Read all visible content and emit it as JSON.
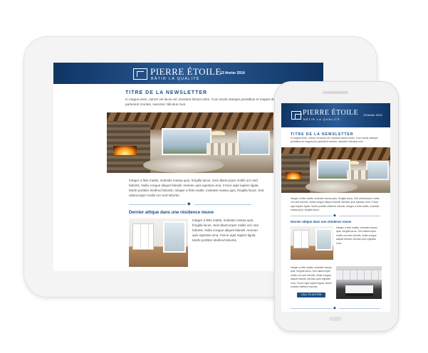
{
  "brand": {
    "name": "PIERRE ÉTOILE",
    "tagline": "BÂTIR LA QUALITÉ"
  },
  "tablet": {
    "header_date": "13 février 2014",
    "newsletter_title": "TITRE DE LA NEWSLETTER",
    "intro_text": "In magna enim, rutrum vel lacus vel, tincidunt dictum enim. Cum sociis natoque penatibus et magnis dis parturient montes, nascetur ridiculus mus.",
    "article_text": "Integer a felis mattis, molestie massa quis, fringilla lacus. Sed ullamcorper mollis orci sed lobortis. Nulla congue aliquet blandit. Aenean quis egestas urna. Fusce eget sapien ligula. Morbi porttitor eleifend lobortis. Integer a felis mattis, molestie massa quis, fringilla lacus. Sed ullamcorper mollis orci sed lobortis.",
    "section_heading": "Dernier attique dans une résidence neuve",
    "section_text": "Integer a felis mattis, molestie massa quis, fringilla lacus. Sed ullamcorper mollis orci sed lobortis. Nulla congue aliquet blandit. Aenean quis egestas urna. Fusce eget sapien ligula. Morbi porttitor eleifend lobortis."
  },
  "phone": {
    "header_date": "13 février 2014",
    "newsletter_title": "TITRE DE LA NEWSLETTER",
    "intro_text": "In magna enim, rutrum vel lacus vel, tincidunt dictum enim. Cum sociis natoque penatibus et magnis dis parturient montes, nascetur ridiculus mus.",
    "article_text": "Integer a felis mattis, molestie massa quis, fringilla lacus. Sed ullamcorper mollis orci sed lobortis. Nulla congue aliquet blandit. Aenean quis egestas urna. Fusce eget sapien ligula. Morbi porttitor eleifend lobortis. Integer a felis mattis, molestie massa quis, fringilla lacus.",
    "section_heading": "Dernier attique dans une résidence neuve",
    "section_text": "Integer a felis mattis, molestie massa quis, fringilla lacus. Sed ullamcorper mollis orci sed lobortis. Nulla congue aliquet blandit. Aenean quis egestas urna.",
    "kitchen_text": "Integer a felis mattis, molestie massa quis, fringilla lacus. Sed ullamcorper mollis orci sed lobortis. Nulla congue aliquet blandit. Aenean quis egestas urna. Fusce eget sapien ligula. Morbi porttitor eleifend lobortis.",
    "cta_label": "CALL TO ACTION"
  },
  "colors": {
    "brand_blue": "#1d4f86",
    "header_dark": "#0f3564"
  },
  "icons": {
    "logo": "house-logo-icon",
    "divider": "diamond-divider-icon"
  }
}
